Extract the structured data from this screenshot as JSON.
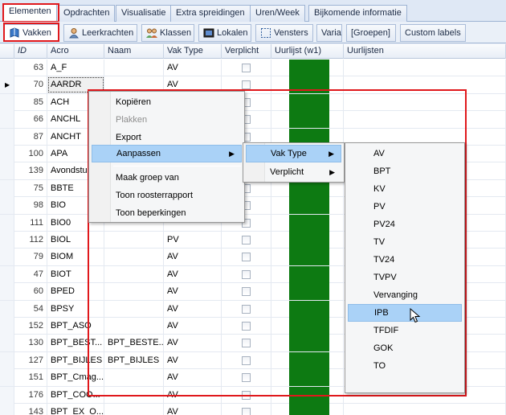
{
  "tabs_top": [
    "Elementen",
    "Opdrachten",
    "Visualisatie",
    "Extra spreidingen",
    "Uren/Week",
    "Bijkomende informatie"
  ],
  "tabs_sub": [
    "Vakken",
    "Leerkrachten",
    "Klassen",
    "Lokalen",
    "Vensters",
    "Varia",
    "[Groepen]",
    "Custom labels"
  ],
  "columns": [
    "ID",
    "Acro",
    "Naam",
    "Vak Type",
    "Verplicht",
    "Uurlijst (w1)",
    "Uurlijsten"
  ],
  "rows": [
    {
      "id": "63",
      "acro": "A_F",
      "naam": "",
      "type": "AV"
    },
    {
      "id": "70",
      "acro": "AARDR",
      "naam": "",
      "type": "AV"
    },
    {
      "id": "85",
      "acro": "ACH",
      "naam": "",
      "type": ""
    },
    {
      "id": "66",
      "acro": "ANCHL",
      "naam": "",
      "type": ""
    },
    {
      "id": "87",
      "acro": "ANCHT",
      "naam": "",
      "type": ""
    },
    {
      "id": "100",
      "acro": "APA",
      "naam": "",
      "type": ""
    },
    {
      "id": "139",
      "acro": "Avondstu",
      "naam": "",
      "type": ""
    },
    {
      "id": "75",
      "acro": "BBTE",
      "naam": "",
      "type": ""
    },
    {
      "id": "98",
      "acro": "BIO",
      "naam": "",
      "type": ""
    },
    {
      "id": "111",
      "acro": "BIO0",
      "naam": "",
      "type": ""
    },
    {
      "id": "112",
      "acro": "BIOL",
      "naam": "",
      "type": "PV"
    },
    {
      "id": "79",
      "acro": "BIOM",
      "naam": "",
      "type": "AV"
    },
    {
      "id": "47",
      "acro": "BIOT",
      "naam": "",
      "type": "AV"
    },
    {
      "id": "60",
      "acro": "BPED",
      "naam": "",
      "type": "AV"
    },
    {
      "id": "54",
      "acro": "BPSY",
      "naam": "",
      "type": "AV"
    },
    {
      "id": "152",
      "acro": "BPT_ASO",
      "naam": "",
      "type": "AV"
    },
    {
      "id": "130",
      "acro": "BPT_BEST...",
      "naam": "BPT_BESTE...",
      "type": "AV"
    },
    {
      "id": "127",
      "acro": "BPT_BIJLES",
      "naam": "BPT_BIJLES",
      "type": "AV"
    },
    {
      "id": "151",
      "acro": "BPT_Cmag...",
      "naam": "",
      "type": "AV"
    },
    {
      "id": "176",
      "acro": "BPT_COO...",
      "naam": "",
      "type": "AV"
    },
    {
      "id": "143",
      "acro": "BPT_EX_O...",
      "naam": "",
      "type": "AV"
    }
  ],
  "menu1": {
    "items": [
      {
        "label": "Kopiëren",
        "state": "normal"
      },
      {
        "label": "Plakken",
        "state": "disabled"
      },
      {
        "label": "Export",
        "state": "normal"
      },
      {
        "label": "Aanpassen",
        "state": "hot",
        "submenu": true
      },
      {
        "label": "Maak groep van",
        "state": "normal"
      },
      {
        "label": "Toon roosterrapport",
        "state": "normal"
      },
      {
        "label": "Toon beperkingen",
        "state": "normal"
      }
    ]
  },
  "menu2": {
    "items": [
      {
        "label": "Vak Type",
        "state": "hot",
        "submenu": true
      },
      {
        "label": "Verplicht",
        "state": "normal",
        "submenu": true
      }
    ]
  },
  "menu3": {
    "items": [
      "AV",
      "BPT",
      "KV",
      "PV",
      "PV24",
      "TV",
      "TV24",
      "TVPV",
      "Vervanging",
      "IPB",
      "TFDIF",
      "GOK",
      "TO"
    ],
    "hot": "IPB"
  },
  "colors": {
    "accent_green": "#0d7a12",
    "highlight_red": "#e0181c",
    "menu_hot": "#aad2f7"
  }
}
